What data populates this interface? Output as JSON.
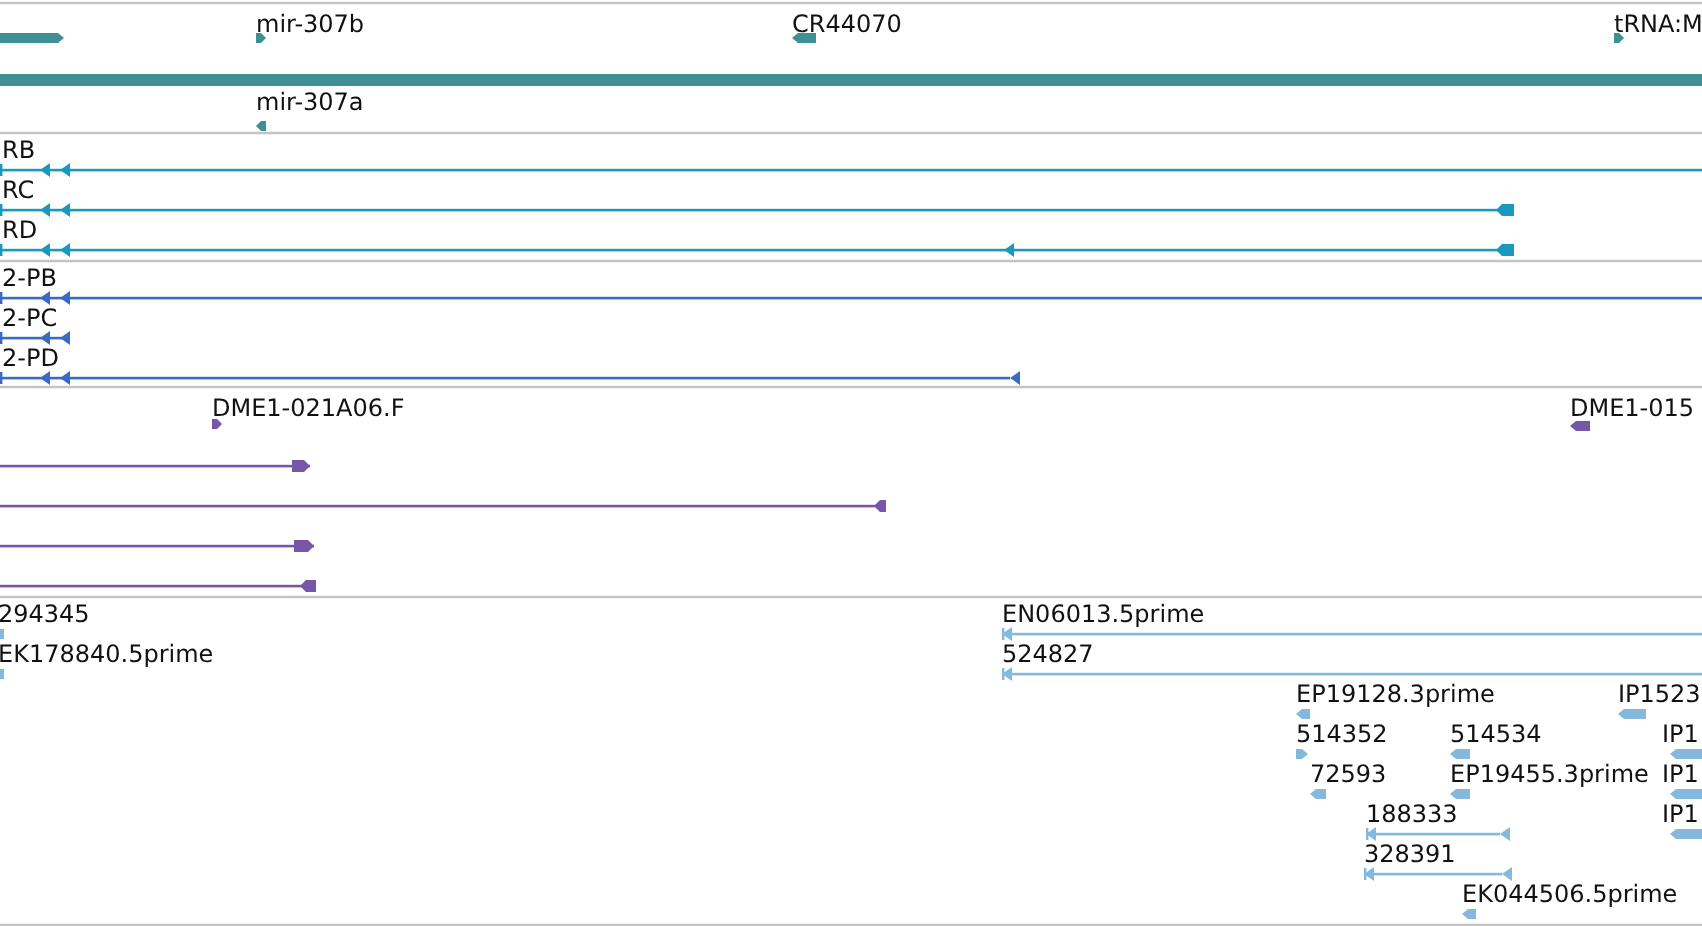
{
  "tracks": [
    {
      "color": "#3f9094",
      "features": [
        {
          "kind": "bar",
          "forward": true
        },
        {
          "kind": "bar",
          "label": "mir-307b",
          "forward": true
        },
        {
          "kind": "bar",
          "label": "CR44070",
          "forward": false
        },
        {
          "kind": "bar",
          "label": "tRNA:M",
          "forward": true
        },
        {
          "kind": "bar"
        },
        {
          "kind": "bar",
          "label": "mir-307a",
          "forward": false
        }
      ]
    },
    {
      "color": "#1999bd",
      "features": [
        {
          "kind": "line",
          "label": "RB",
          "forward": false
        },
        {
          "kind": "line",
          "label": "RC",
          "forward": false
        },
        {
          "kind": "line",
          "label": "RD",
          "forward": false
        }
      ]
    },
    {
      "color": "#3a69c6",
      "features": [
        {
          "kind": "line",
          "label": "2-PB",
          "forward": false
        },
        {
          "kind": "line",
          "label": "2-PC",
          "forward": false
        },
        {
          "kind": "line",
          "label": "2-PD",
          "forward": false
        }
      ]
    },
    {
      "color": "#7656a6",
      "features": [
        {
          "kind": "bar",
          "label": "DME1-021A06.F",
          "forward": true
        },
        {
          "kind": "bar",
          "label": "DME1-015",
          "forward": false
        },
        {
          "kind": "line",
          "forward": true
        },
        {
          "kind": "line",
          "forward": false
        },
        {
          "kind": "line",
          "forward": true
        },
        {
          "kind": "line",
          "forward": false
        }
      ]
    },
    {
      "color": "#84b9dd",
      "features": [
        {
          "kind": "bar",
          "label": "294345"
        },
        {
          "kind": "bar",
          "label": "EK178840.5prime"
        },
        {
          "kind": "line",
          "label": "EN06013.5prime",
          "forward": false
        },
        {
          "kind": "line",
          "label": "524827",
          "forward": false
        },
        {
          "kind": "bar",
          "label": "EP19128.3prime",
          "forward": false
        },
        {
          "kind": "bar",
          "label": "IP1523",
          "forward": false
        },
        {
          "kind": "bar",
          "label": "514352",
          "forward": true
        },
        {
          "kind": "bar",
          "label": "514534",
          "forward": false
        },
        {
          "kind": "bar",
          "label": "IP1",
          "forward": false
        },
        {
          "kind": "bar",
          "label": "72593",
          "forward": false
        },
        {
          "kind": "bar",
          "label": "EP19455.3prime",
          "forward": false
        },
        {
          "kind": "bar",
          "label": "IP1",
          "forward": false
        },
        {
          "kind": "line",
          "label": "188333",
          "forward": false
        },
        {
          "kind": "bar",
          "label": "IP1",
          "forward": false
        },
        {
          "kind": "line",
          "label": "328391",
          "forward": false
        },
        {
          "kind": "bar",
          "label": "EK044506.5prime",
          "forward": false
        }
      ]
    }
  ]
}
